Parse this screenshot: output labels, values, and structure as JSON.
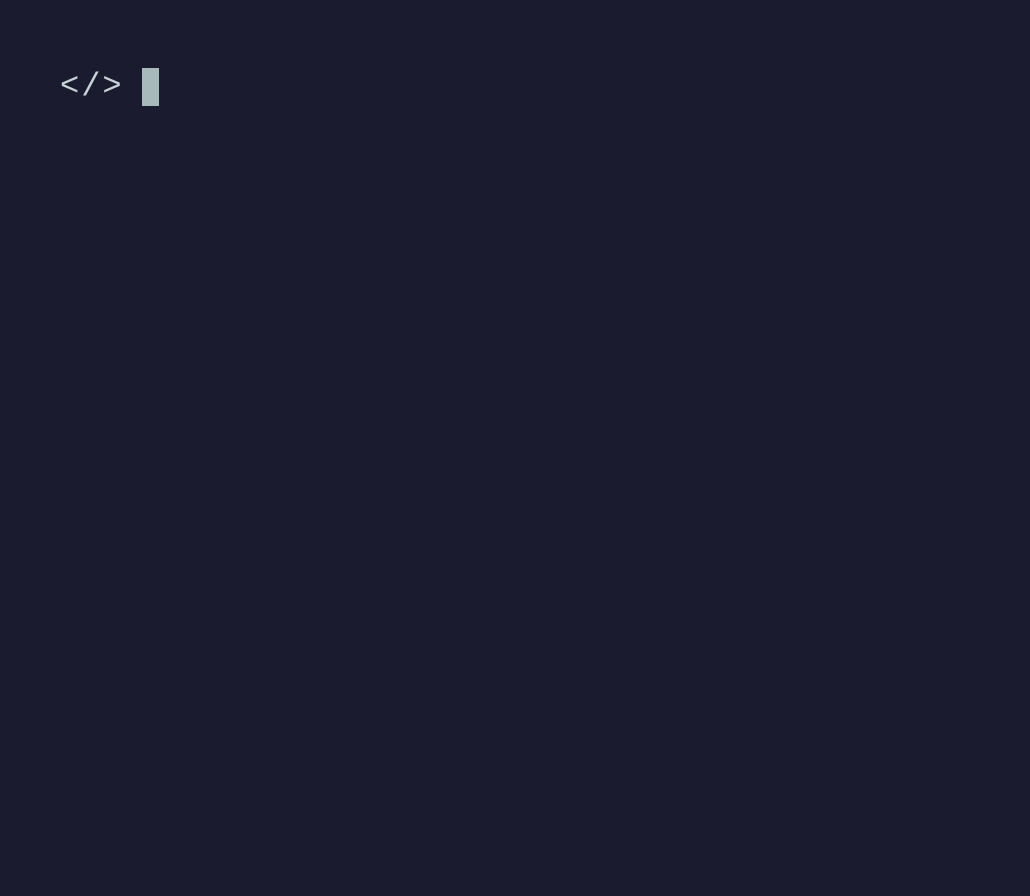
{
  "terminal": {
    "prompt_symbol": "</>",
    "input_value": ""
  },
  "colors": {
    "background": "#1b1b2f",
    "prompt_text": "#c5d3d6",
    "cursor": "#a8b9bc"
  }
}
